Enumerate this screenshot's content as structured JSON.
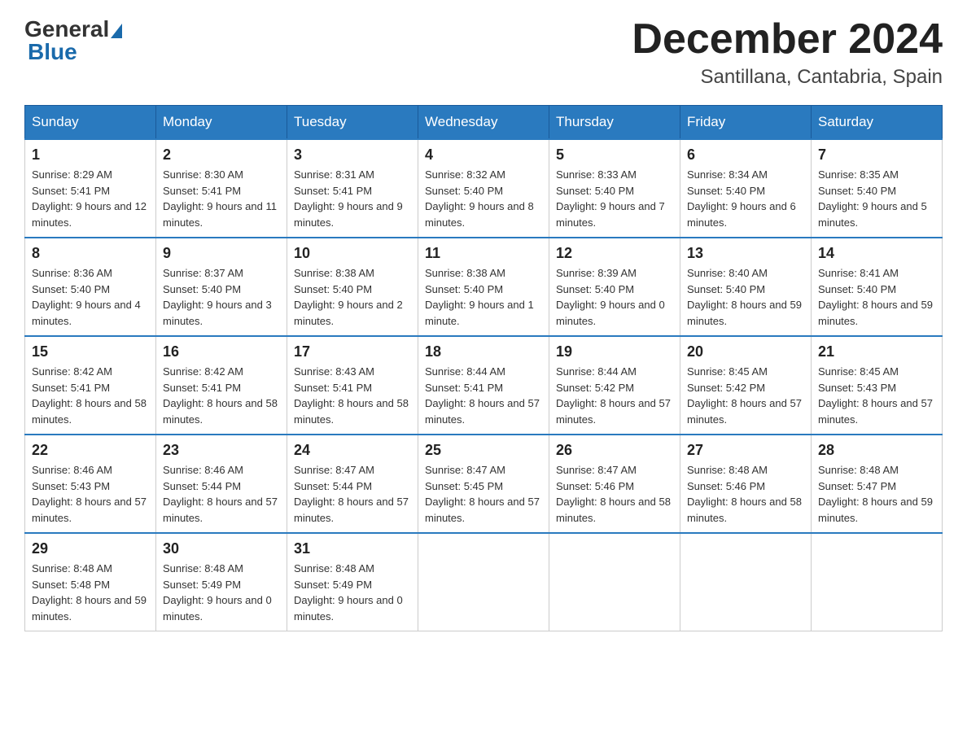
{
  "header": {
    "month_title": "December 2024",
    "location": "Santillana, Cantabria, Spain",
    "logo_general": "General",
    "logo_blue": "Blue"
  },
  "weekdays": [
    "Sunday",
    "Monday",
    "Tuesday",
    "Wednesday",
    "Thursday",
    "Friday",
    "Saturday"
  ],
  "weeks": [
    [
      {
        "day": "1",
        "sunrise": "8:29 AM",
        "sunset": "5:41 PM",
        "daylight": "9 hours and 12 minutes."
      },
      {
        "day": "2",
        "sunrise": "8:30 AM",
        "sunset": "5:41 PM",
        "daylight": "9 hours and 11 minutes."
      },
      {
        "day": "3",
        "sunrise": "8:31 AM",
        "sunset": "5:41 PM",
        "daylight": "9 hours and 9 minutes."
      },
      {
        "day": "4",
        "sunrise": "8:32 AM",
        "sunset": "5:40 PM",
        "daylight": "9 hours and 8 minutes."
      },
      {
        "day": "5",
        "sunrise": "8:33 AM",
        "sunset": "5:40 PM",
        "daylight": "9 hours and 7 minutes."
      },
      {
        "day": "6",
        "sunrise": "8:34 AM",
        "sunset": "5:40 PM",
        "daylight": "9 hours and 6 minutes."
      },
      {
        "day": "7",
        "sunrise": "8:35 AM",
        "sunset": "5:40 PM",
        "daylight": "9 hours and 5 minutes."
      }
    ],
    [
      {
        "day": "8",
        "sunrise": "8:36 AM",
        "sunset": "5:40 PM",
        "daylight": "9 hours and 4 minutes."
      },
      {
        "day": "9",
        "sunrise": "8:37 AM",
        "sunset": "5:40 PM",
        "daylight": "9 hours and 3 minutes."
      },
      {
        "day": "10",
        "sunrise": "8:38 AM",
        "sunset": "5:40 PM",
        "daylight": "9 hours and 2 minutes."
      },
      {
        "day": "11",
        "sunrise": "8:38 AM",
        "sunset": "5:40 PM",
        "daylight": "9 hours and 1 minute."
      },
      {
        "day": "12",
        "sunrise": "8:39 AM",
        "sunset": "5:40 PM",
        "daylight": "9 hours and 0 minutes."
      },
      {
        "day": "13",
        "sunrise": "8:40 AM",
        "sunset": "5:40 PM",
        "daylight": "8 hours and 59 minutes."
      },
      {
        "day": "14",
        "sunrise": "8:41 AM",
        "sunset": "5:40 PM",
        "daylight": "8 hours and 59 minutes."
      }
    ],
    [
      {
        "day": "15",
        "sunrise": "8:42 AM",
        "sunset": "5:41 PM",
        "daylight": "8 hours and 58 minutes."
      },
      {
        "day": "16",
        "sunrise": "8:42 AM",
        "sunset": "5:41 PM",
        "daylight": "8 hours and 58 minutes."
      },
      {
        "day": "17",
        "sunrise": "8:43 AM",
        "sunset": "5:41 PM",
        "daylight": "8 hours and 58 minutes."
      },
      {
        "day": "18",
        "sunrise": "8:44 AM",
        "sunset": "5:41 PM",
        "daylight": "8 hours and 57 minutes."
      },
      {
        "day": "19",
        "sunrise": "8:44 AM",
        "sunset": "5:42 PM",
        "daylight": "8 hours and 57 minutes."
      },
      {
        "day": "20",
        "sunrise": "8:45 AM",
        "sunset": "5:42 PM",
        "daylight": "8 hours and 57 minutes."
      },
      {
        "day": "21",
        "sunrise": "8:45 AM",
        "sunset": "5:43 PM",
        "daylight": "8 hours and 57 minutes."
      }
    ],
    [
      {
        "day": "22",
        "sunrise": "8:46 AM",
        "sunset": "5:43 PM",
        "daylight": "8 hours and 57 minutes."
      },
      {
        "day": "23",
        "sunrise": "8:46 AM",
        "sunset": "5:44 PM",
        "daylight": "8 hours and 57 minutes."
      },
      {
        "day": "24",
        "sunrise": "8:47 AM",
        "sunset": "5:44 PM",
        "daylight": "8 hours and 57 minutes."
      },
      {
        "day": "25",
        "sunrise": "8:47 AM",
        "sunset": "5:45 PM",
        "daylight": "8 hours and 57 minutes."
      },
      {
        "day": "26",
        "sunrise": "8:47 AM",
        "sunset": "5:46 PM",
        "daylight": "8 hours and 58 minutes."
      },
      {
        "day": "27",
        "sunrise": "8:48 AM",
        "sunset": "5:46 PM",
        "daylight": "8 hours and 58 minutes."
      },
      {
        "day": "28",
        "sunrise": "8:48 AM",
        "sunset": "5:47 PM",
        "daylight": "8 hours and 59 minutes."
      }
    ],
    [
      {
        "day": "29",
        "sunrise": "8:48 AM",
        "sunset": "5:48 PM",
        "daylight": "8 hours and 59 minutes."
      },
      {
        "day": "30",
        "sunrise": "8:48 AM",
        "sunset": "5:49 PM",
        "daylight": "9 hours and 0 minutes."
      },
      {
        "day": "31",
        "sunrise": "8:48 AM",
        "sunset": "5:49 PM",
        "daylight": "9 hours and 0 minutes."
      },
      null,
      null,
      null,
      null
    ]
  ]
}
